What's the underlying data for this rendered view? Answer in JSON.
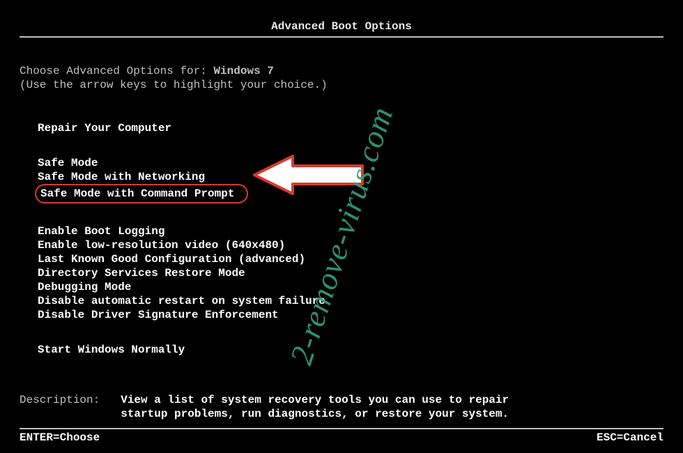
{
  "title": "Advanced Boot Options",
  "intro": {
    "prefix": "Choose Advanced Options for: ",
    "os": "Windows 7",
    "hint": "(Use the arrow keys to highlight your choice.)"
  },
  "menu": {
    "group1": [
      "Repair Your Computer"
    ],
    "group2": [
      "Safe Mode",
      "Safe Mode with Networking",
      "Safe Mode with Command Prompt"
    ],
    "group3": [
      "Enable Boot Logging",
      "Enable low-resolution video (640x480)",
      "Last Known Good Configuration (advanced)",
      "Directory Services Restore Mode",
      "Debugging Mode",
      "Disable automatic restart on system failure",
      "Disable Driver Signature Enforcement"
    ],
    "group4": [
      "Start Windows Normally"
    ],
    "selected_index_in_group2": 2
  },
  "description": {
    "label": "Description:",
    "body": "View a list of system recovery tools you can use to repair startup problems, run diagnostics, or restore your system."
  },
  "footer": {
    "left": "ENTER=Choose",
    "right": "ESC=Cancel"
  },
  "annotation": {
    "arrow_icon": "arrow-left-icon",
    "watermark_text": "2-remove-virus.com"
  }
}
